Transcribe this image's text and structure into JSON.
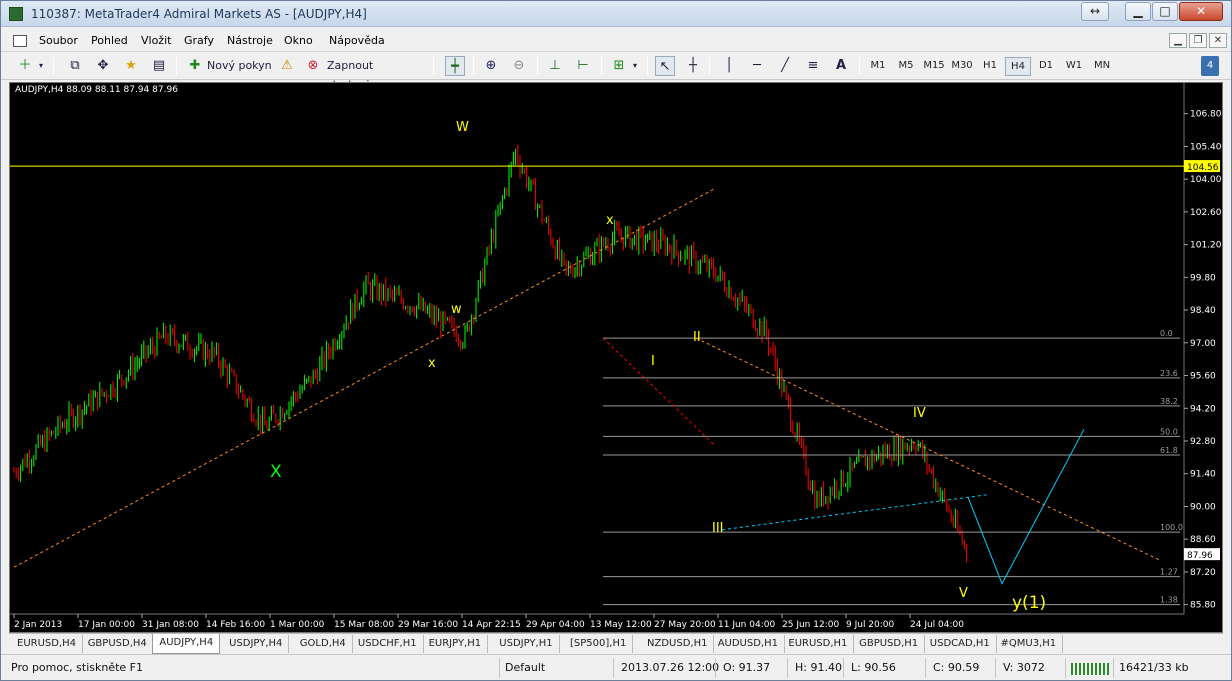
{
  "window": {
    "title": "110387: MetaTrader4 Admiral Markets AS - [AUDJPY,H4]"
  },
  "menu": [
    "Soubor",
    "Pohled",
    "Vložit",
    "Grafy",
    "Nástroje",
    "Okno",
    "Nápověda"
  ],
  "toolbar": {
    "new_order": "Nový pokyn",
    "autotrading": "Zapnout strategie",
    "text_tool": "A",
    "timeframes": [
      "M1",
      "M5",
      "M15",
      "M30",
      "H1",
      "H4",
      "D1",
      "W1",
      "MN"
    ],
    "active_timeframe": "H4",
    "badge": "4"
  },
  "chart": {
    "info": "AUDJPY,H4  88.09 88.11 87.94 87.96",
    "colors": {
      "background": "#000000",
      "bull": "#00ff00",
      "bear": "#ff0000",
      "trendline": "#ff8c1a",
      "hline": "#ffff00",
      "fibo": "#9a9a9a",
      "wave": "#00ccff",
      "label_yellow": "#ffff00",
      "label_green": "#00ff00"
    }
  },
  "chart_data": {
    "type": "candlestick",
    "symbol": "AUDJPY",
    "timeframe": "H4",
    "y_ticks": [
      "106.80",
      "105.40",
      "104.00",
      "102.60",
      "101.20",
      "99.80",
      "98.40",
      "97.00",
      "95.60",
      "94.20",
      "92.80",
      "91.40",
      "90.00",
      "88.60",
      "87.20",
      "85.80"
    ],
    "ylim": [
      85.4,
      107.6
    ],
    "x_ticks": [
      "2 Jan 2013",
      "17 Jan 00:00",
      "31 Jan 08:00",
      "14 Feb 16:00",
      "1 Mar 00:00",
      "15 Mar 08:00",
      "29 Mar 16:00",
      "14 Apr 22:15",
      "29 Apr 04:00",
      "13 May 12:00",
      "27 May 20:00",
      "11 Jun 04:00",
      "25 Jun 12:00",
      "9 Jul 20:00",
      "24 Jul 04:00"
    ],
    "price_path": [
      [
        0,
        91.5
      ],
      [
        1,
        93.6
      ],
      [
        2,
        95.2
      ],
      [
        3,
        97.3
      ],
      [
        4,
        96.5
      ],
      [
        5,
        93.4
      ],
      [
        6,
        95.6
      ],
      [
        7,
        99.4
      ],
      [
        8,
        98.6
      ],
      [
        9,
        97.2
      ],
      [
        10,
        105.2
      ],
      [
        11,
        100.0
      ],
      [
        12,
        101.6
      ],
      [
        13,
        101.2
      ],
      [
        14,
        100.0
      ],
      [
        15,
        97.4
      ],
      [
        16,
        90.2
      ],
      [
        17,
        92.0
      ],
      [
        18,
        92.8
      ],
      [
        19,
        88.1
      ]
    ],
    "horizontal_line": 104.56,
    "current_price": "87.96",
    "fibonacci": [
      {
        "label": "0.0",
        "price": 97.2
      },
      {
        "label": "23.6",
        "price": 95.5
      },
      {
        "label": "38.2",
        "price": 94.3
      },
      {
        "label": "50.0",
        "price": 93.0
      },
      {
        "label": "61.8",
        "price": 92.2
      },
      {
        "label": "100.0",
        "price": 88.9
      },
      {
        "label": "1.27",
        "price": 87.0
      },
      {
        "label": "1.38",
        "price": 85.8
      }
    ],
    "wave_labels": [
      {
        "text": "W",
        "color": "yellow"
      },
      {
        "text": "w",
        "color": "yellow"
      },
      {
        "text": "x",
        "color": "yellow"
      },
      {
        "text": "x",
        "color": "yellow"
      },
      {
        "text": "X",
        "color": "green"
      },
      {
        "text": "I",
        "color": "yellow"
      },
      {
        "text": "II",
        "color": "yellow"
      },
      {
        "text": "III",
        "color": "yellow"
      },
      {
        "text": "IV",
        "color": "yellow"
      },
      {
        "text": "V",
        "color": "yellow"
      },
      {
        "text": "y(1)",
        "color": "yellow"
      }
    ]
  },
  "tabs": [
    "EURUSD,H4",
    "GBPUSD,H4",
    "AUDJPY,H4",
    "USDJPY,H4",
    "GOLD,H4",
    "USDCHF,H1",
    "EURJPY,H1",
    "USDJPY,H1",
    "[SP500],H1",
    "NZDUSD,H1",
    "AUDUSD,H1",
    "EURUSD,H1",
    "GBPUSD,H1",
    "USDCAD,H1",
    "#QMU3,H1"
  ],
  "active_tab": "AUDJPY,H4",
  "status": {
    "help": "Pro pomoc, stiskněte F1",
    "profile": "Default",
    "datetime": "2013.07.26 12:00",
    "open": "O: 91.37",
    "high": "H: 91.40",
    "low": "L: 90.56",
    "close": "C: 90.59",
    "volume": "V: 3072",
    "traffic": "16421/33 kb"
  }
}
